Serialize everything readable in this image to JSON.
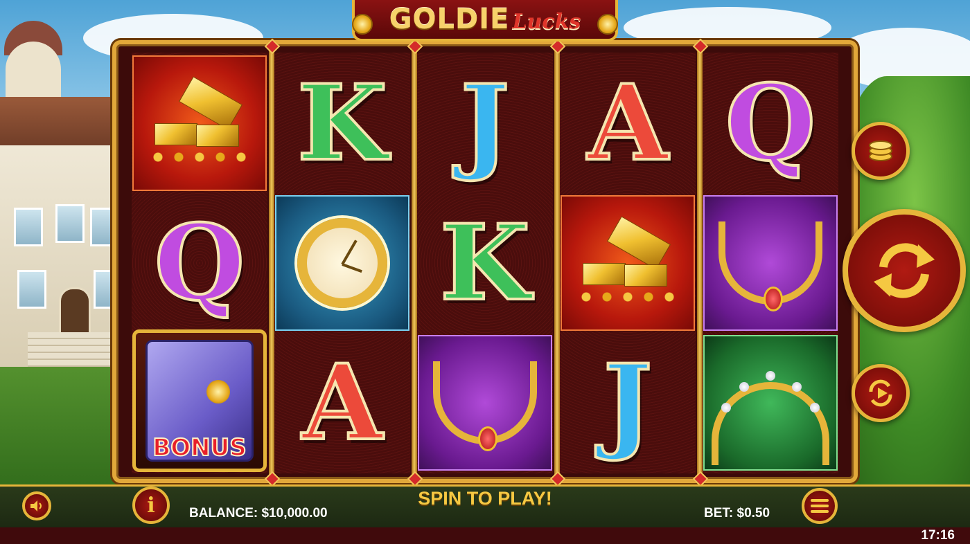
{
  "game": {
    "logo_main": "GOLDIE",
    "logo_sub": "Lucks"
  },
  "reels": [
    [
      {
        "symbol": "gold-bars"
      },
      {
        "symbol": "Q",
        "color": "purple"
      },
      {
        "symbol": "safe-bonus",
        "label": "BONUS"
      }
    ],
    [
      {
        "symbol": "K",
        "color": "green"
      },
      {
        "symbol": "watch"
      },
      {
        "symbol": "A",
        "color": "red"
      }
    ],
    [
      {
        "symbol": "J",
        "color": "blue"
      },
      {
        "symbol": "K",
        "color": "green"
      },
      {
        "symbol": "necklace"
      }
    ],
    [
      {
        "symbol": "A",
        "color": "red"
      },
      {
        "symbol": "gold-bars"
      },
      {
        "symbol": "J",
        "color": "blue"
      }
    ],
    [
      {
        "symbol": "Q",
        "color": "purple"
      },
      {
        "symbol": "necklace"
      },
      {
        "symbol": "tiara"
      }
    ]
  ],
  "labels": {
    "r0s1": "Q",
    "r0s2": "BONUS",
    "r1s0": "K",
    "r1s2": "A",
    "r2s0": "J",
    "r2s1": "K",
    "r3s0": "A",
    "r3s2": "J",
    "r4s0": "Q"
  },
  "controls": {
    "bet_coins_icon": "coins-icon",
    "spin_icon": "spin-arrows-icon",
    "autoplay_icon": "autoplay-icon",
    "sound_icon": "speaker-icon",
    "info_icon": "info-icon",
    "menu_icon": "menu-icon",
    "info_glyph": "i"
  },
  "status": {
    "balance": "BALANCE: $10,000.00",
    "message": "SPIN TO PLAY!",
    "bet": "BET: $0.50",
    "clock": "17:16"
  },
  "colors": {
    "gold": "#e6b53a",
    "frame_red": "#8a1212",
    "message_yellow": "#f5c842"
  }
}
